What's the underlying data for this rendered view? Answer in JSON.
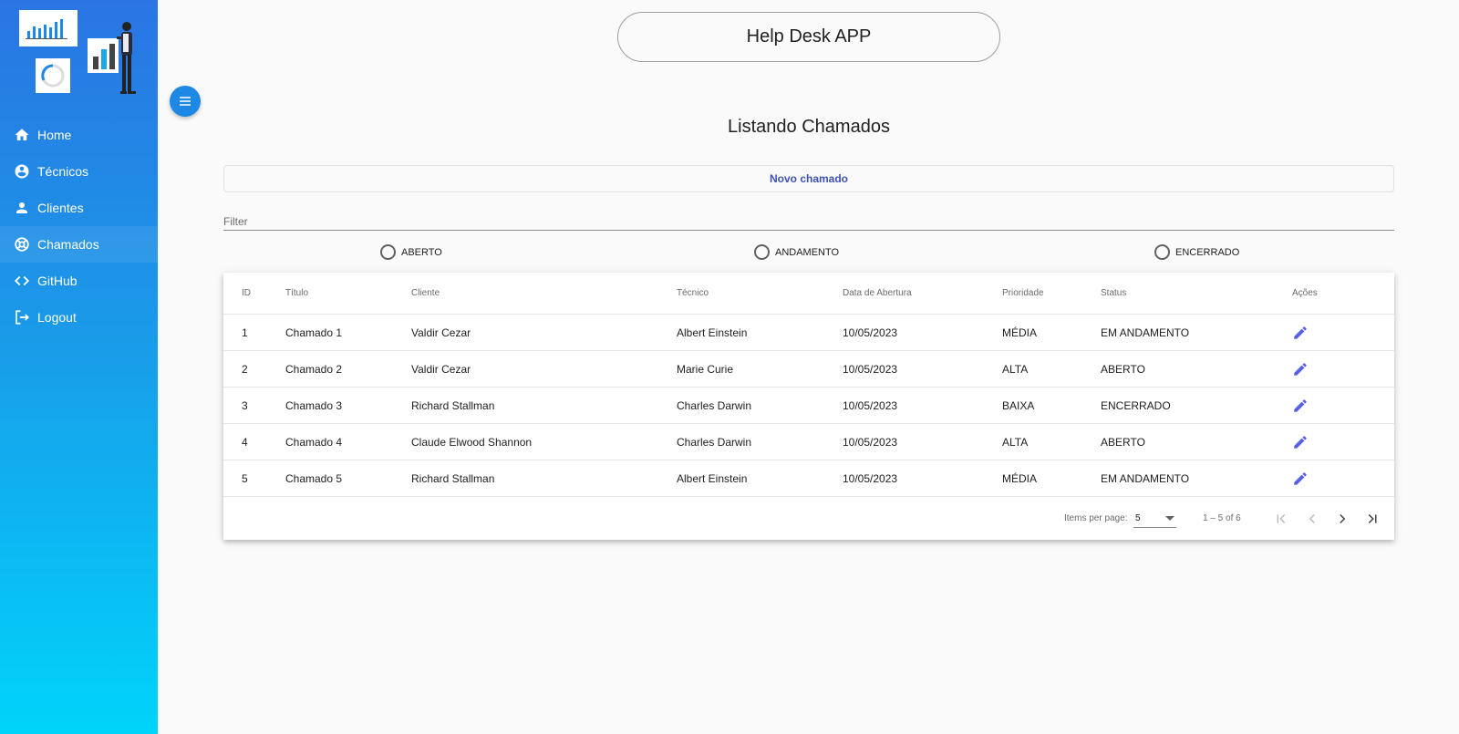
{
  "app": {
    "title": "Help Desk APP"
  },
  "sidebar": {
    "items": [
      {
        "label": "Home",
        "icon": "home-icon"
      },
      {
        "label": "Técnicos",
        "icon": "account-circle-icon"
      },
      {
        "label": "Clientes",
        "icon": "person-icon"
      },
      {
        "label": "Chamados",
        "icon": "support-icon",
        "active": true
      },
      {
        "label": "GitHub",
        "icon": "code-icon"
      },
      {
        "label": "Logout",
        "icon": "logout-icon"
      }
    ]
  },
  "page": {
    "title": "Listando Chamados",
    "new_button": "Novo chamado",
    "filter_placeholder": "Filter",
    "status_filters": [
      "ABERTO",
      "ANDAMENTO",
      "ENCERRADO"
    ]
  },
  "table": {
    "columns": [
      "ID",
      "Título",
      "Cliente",
      "Técnico",
      "Data de Abertura",
      "Prioridade",
      "Status",
      "Ações"
    ],
    "rows": [
      {
        "id": "1",
        "titulo": "Chamado 1",
        "cliente": "Valdir Cezar",
        "tecnico": "Albert Einstein",
        "data": "10/05/2023",
        "prioridade": "MÉDIA",
        "status": "EM ANDAMENTO"
      },
      {
        "id": "2",
        "titulo": "Chamado 2",
        "cliente": "Valdir Cezar",
        "tecnico": "Marie Curie",
        "data": "10/05/2023",
        "prioridade": "ALTA",
        "status": "ABERTO"
      },
      {
        "id": "3",
        "titulo": "Chamado 3",
        "cliente": "Richard Stallman",
        "tecnico": "Charles Darwin",
        "data": "10/05/2023",
        "prioridade": "BAIXA",
        "status": "ENCERRADO"
      },
      {
        "id": "4",
        "titulo": "Chamado 4",
        "cliente": "Claude Elwood Shannon",
        "tecnico": "Charles Darwin",
        "data": "10/05/2023",
        "prioridade": "ALTA",
        "status": "ABERTO"
      },
      {
        "id": "5",
        "titulo": "Chamado 5",
        "cliente": "Richard Stallman",
        "tecnico": "Albert Einstein",
        "data": "10/05/2023",
        "prioridade": "MÉDIA",
        "status": "EM ANDAMENTO"
      }
    ]
  },
  "paginator": {
    "items_per_page_label": "Items per page:",
    "page_size": "5",
    "range": "1 – 5 of 6"
  },
  "colors": {
    "sidebar_top": "#2a75e3",
    "sidebar_bottom": "#00d4fb",
    "menu_button": "#1e88e5",
    "primary_text": "#3f51b5",
    "edit_icon": "#5b5fe8"
  }
}
